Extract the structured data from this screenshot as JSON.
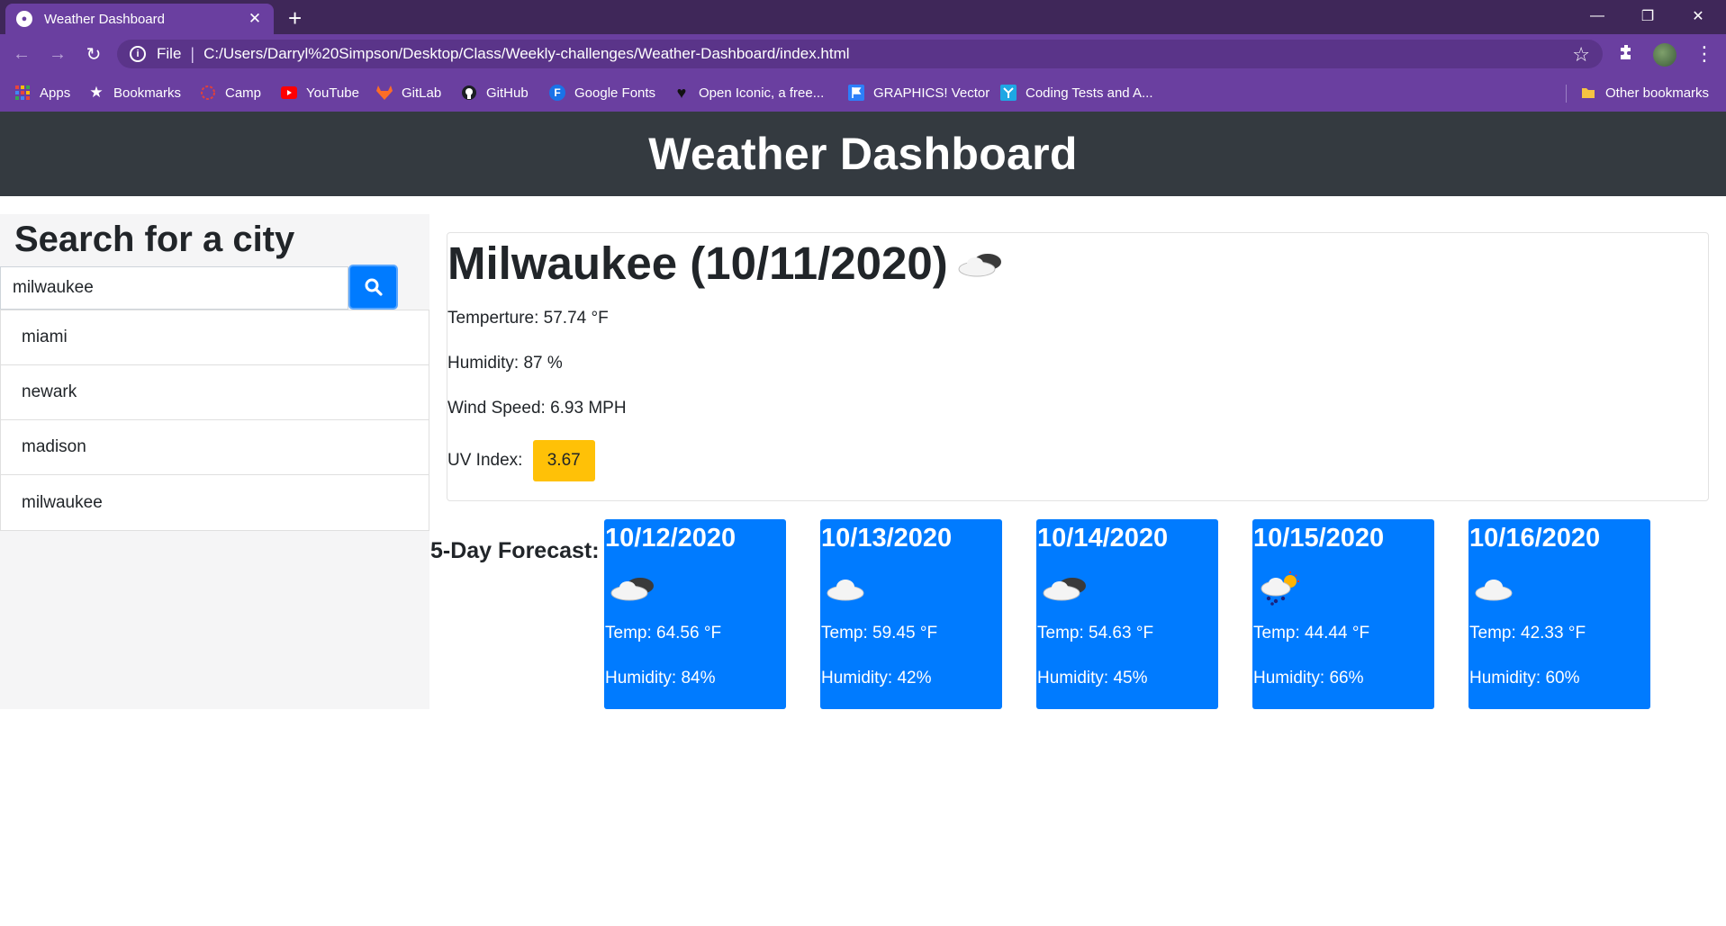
{
  "browser": {
    "tab_title": "Weather Dashboard",
    "url_scheme": "File",
    "url": "C:/Users/Darryl%20Simpson/Desktop/Class/Weekly-challenges/Weather-Dashboard/index.html",
    "bookmarks": [
      {
        "label": "Apps",
        "icon": "apps-grid-icon",
        "color": "#e8453c"
      },
      {
        "label": "Bookmarks",
        "icon": "star-icon",
        "color": "#ffffff"
      },
      {
        "label": "Camp",
        "icon": "camp-icon",
        "color": "#e0413b"
      },
      {
        "label": "YouTube",
        "icon": "youtube-icon",
        "color": "#ff0000"
      },
      {
        "label": "GitLab",
        "icon": "gitlab-icon",
        "color": "#fc6d26"
      },
      {
        "label": "GitHub",
        "icon": "github-icon",
        "color": "#ffffff"
      },
      {
        "label": "Google Fonts",
        "icon": "google-fonts-icon",
        "color": "#1a73e8"
      },
      {
        "label": "Open Iconic, a free...",
        "icon": "heart-icon",
        "color": "#111111"
      },
      {
        "label": "GRAPHICS! Vector",
        "icon": "flag-icon",
        "color": "#2d7ff9"
      },
      {
        "label": "Coding Tests and A...",
        "icon": "coding-tests-icon",
        "color": "#1ea7e4"
      }
    ],
    "other_bookmarks": "Other bookmarks"
  },
  "header": {
    "title": "Weather Dashboard"
  },
  "search": {
    "title": "Search for a city",
    "value": "milwaukee",
    "history": [
      "miami",
      "newark",
      "madison",
      "milwaukee"
    ]
  },
  "current": {
    "heading": "Milwaukee (10/11/2020)",
    "icon": "cloudy-icon",
    "temperature": "Temperture: 57.74 °F",
    "humidity": "Humidity: 87 %",
    "wind": "Wind Speed: 6.93 MPH",
    "uv_label": "UV Index:",
    "uv_value": "3.67",
    "uv_color": "#ffc107"
  },
  "forecast": {
    "label": "5-Day Forecast:",
    "card_color": "#007bff",
    "days": [
      {
        "date": "10/12/2020",
        "icon": "broken-clouds-icon",
        "temp": "Temp: 64.56 °F",
        "humidity": "Humidity: 84%"
      },
      {
        "date": "10/13/2020",
        "icon": "cloud-icon",
        "temp": "Temp: 59.45 °F",
        "humidity": "Humidity: 42%"
      },
      {
        "date": "10/14/2020",
        "icon": "broken-clouds-icon",
        "temp": "Temp: 54.63 °F",
        "humidity": "Humidity: 45%"
      },
      {
        "date": "10/15/2020",
        "icon": "rain-sun-icon",
        "temp": "Temp: 44.44 °F",
        "humidity": "Humidity: 66%"
      },
      {
        "date": "10/16/2020",
        "icon": "cloud-icon",
        "temp": "Temp: 42.33 °F",
        "humidity": "Humidity: 60%"
      }
    ]
  }
}
